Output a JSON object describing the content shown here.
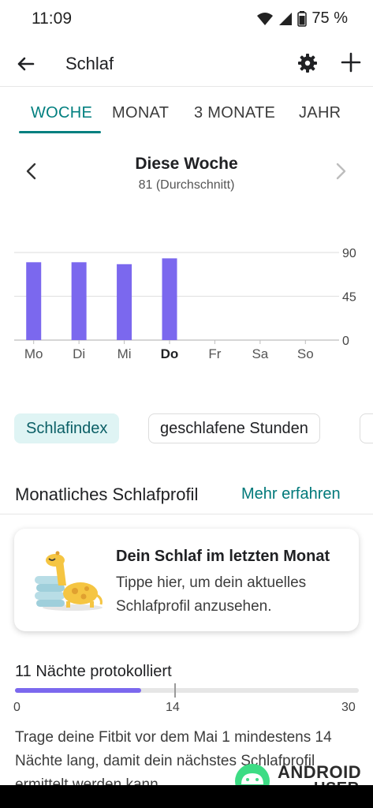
{
  "status_bar": {
    "time": "11:09",
    "battery": "75 %",
    "icons": [
      "wifi-icon",
      "signal-icon",
      "battery-icon"
    ]
  },
  "app_bar": {
    "title": "Schlaf",
    "icons": [
      "arrow-back-icon",
      "gear-icon",
      "plus-icon"
    ]
  },
  "tabs": [
    {
      "label": "WOCHE",
      "active": true
    },
    {
      "label": "MONAT",
      "active": false
    },
    {
      "label": "3 MONATE",
      "active": false
    },
    {
      "label": "JAHR",
      "active": false
    }
  ],
  "period": {
    "title": "Diese Woche",
    "subtitle": "81 (Durchschnitt)"
  },
  "chart_data": {
    "type": "bar",
    "categories": [
      "Mo",
      "Di",
      "Mi",
      "Do",
      "Fr",
      "Sa",
      "So"
    ],
    "highlighted_category": "Do",
    "values": [
      80,
      80,
      78,
      84,
      null,
      null,
      null
    ],
    "yticks": [
      0,
      45,
      90
    ],
    "ylim": [
      0,
      90
    ],
    "grid": true,
    "bar_color": "#7b68ee"
  },
  "chips": {
    "selected": "Schlafindex",
    "other": "geschlafene Stunden"
  },
  "profile_section": {
    "title": "Monatliches Schlafprofil",
    "link": "Mehr erfahren"
  },
  "profile_card": {
    "title": "Dein Schlaf im letzten Monat",
    "text": "Tippe hier, um dein aktuelles Schlafprofil anzusehen."
  },
  "nights": {
    "label": "11 Nächte protokolliert",
    "logged": 11,
    "max": 30,
    "start_label": "0",
    "mid_label": "14",
    "end_label": "30",
    "fill_color": "#7b68ee"
  },
  "info": {
    "text": "Trage deine Fitbit vor dem Mai 1 mindestens 14 Nächte lang, damit dein nächstes Schlafprofil ermittelt werden kann."
  },
  "watermark": {
    "line1": "ANDROID",
    "line2": "USER"
  },
  "colors": {
    "accent": "#007f7f",
    "bar": "#7b68ee"
  }
}
